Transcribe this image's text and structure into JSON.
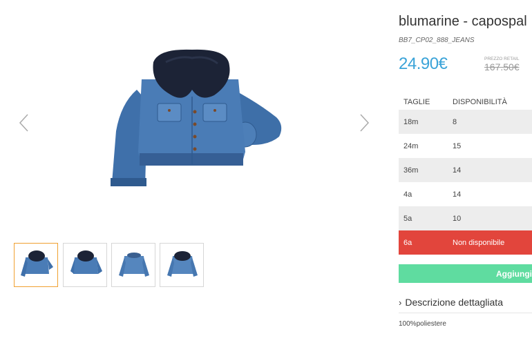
{
  "product": {
    "title": "blumarine - capospal",
    "sku": "BB7_CP02_888_JEANS",
    "price": "24.90€",
    "retail_label": "PREZZO RETAIL",
    "retail_price": "167.50€"
  },
  "sizes": {
    "header_size": "TAGLIE",
    "header_availability": "DISPONIBILITÀ",
    "rows": [
      {
        "size": "18m",
        "availability": "8"
      },
      {
        "size": "24m",
        "availability": "15"
      },
      {
        "size": "36m",
        "availability": "14"
      },
      {
        "size": "4a",
        "availability": "14"
      },
      {
        "size": "5a",
        "availability": "10"
      },
      {
        "size": "6a",
        "availability": "Non disponibile"
      }
    ]
  },
  "actions": {
    "add_label": "Aggiungi a",
    "description_label": "Descrizione dettagliata",
    "description_text": "100%poliestere"
  },
  "gallery": {
    "icons": {
      "prev": "chevron-left-icon",
      "next": "chevron-right-icon"
    },
    "thumb_count": 4,
    "active_thumb": 1
  },
  "colors": {
    "price": "#3aa3d8",
    "add_button": "#5fdca0",
    "unavailable": "#e2453c",
    "active_thumb_border": "#f0a030"
  }
}
